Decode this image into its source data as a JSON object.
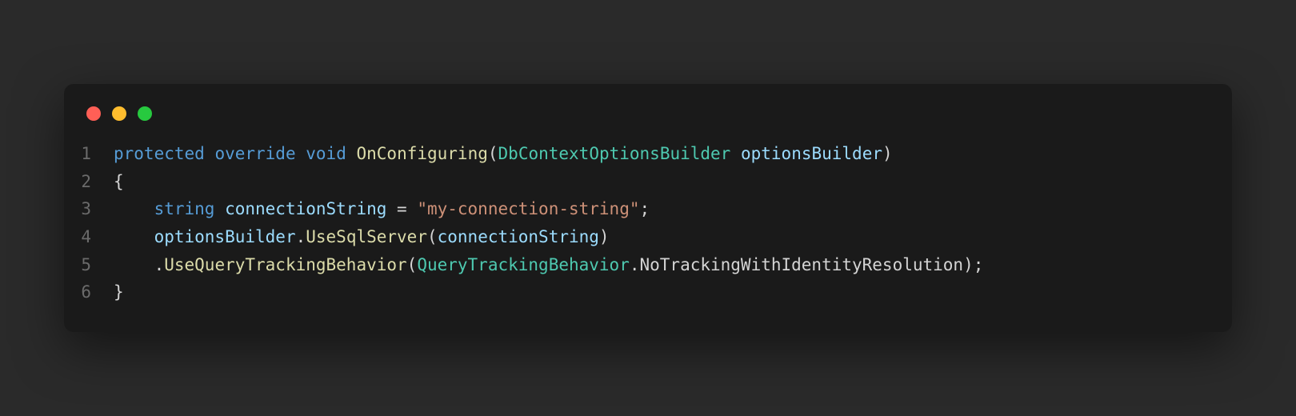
{
  "traffic_lights": {
    "red": "#ff5f56",
    "yellow": "#ffbd2e",
    "green": "#27c93f"
  },
  "gutter": [
    "1",
    "2",
    "3",
    "4",
    "5",
    "6"
  ],
  "code": {
    "l1": {
      "kw1": "protected",
      "kw2": "override",
      "kw3": "void",
      "method": "OnConfiguring",
      "lparen": "(",
      "ptype": "DbContextOptionsBuilder",
      "pname": "optionsBuilder",
      "rparen": ")"
    },
    "l2": {
      "brace": "{"
    },
    "l3": {
      "kw": "string",
      "var": "connectionString",
      "eq": " = ",
      "str": "\"my-connection-string\"",
      "semi": ";"
    },
    "l4": {
      "obj": "optionsBuilder",
      "dot": ".",
      "method": "UseSqlServer",
      "lparen": "(",
      "arg": "connectionString",
      "rparen": ")"
    },
    "l5": {
      "dot": ".",
      "method": "UseQueryTrackingBehavior",
      "lparen": "(",
      "enum": "QueryTrackingBehavior",
      "dot2": ".",
      "member": "NoTrackingWithIdentityResolution",
      "rparen": ")",
      "semi": ";"
    },
    "l6": {
      "brace": "}"
    }
  }
}
